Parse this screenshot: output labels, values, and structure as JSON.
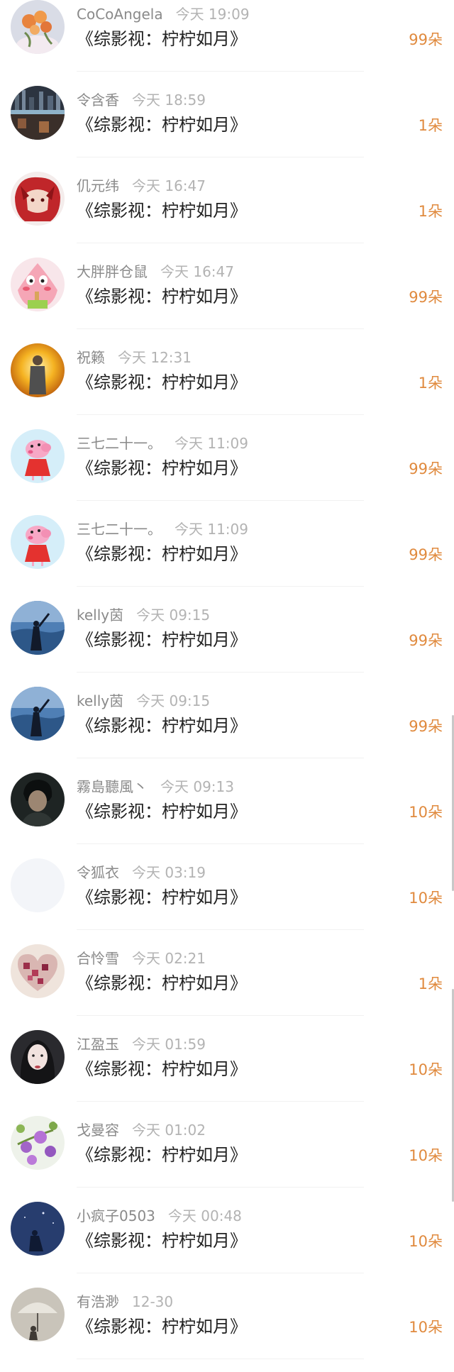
{
  "colors": {
    "gift_count": "#e08a3e",
    "name": "#8a8a8a",
    "time": "#b3b3b3",
    "title": "#222222"
  },
  "entries": [
    {
      "name": "CoCoAngela",
      "time": "今天 19:09",
      "title": "《综影视：柠柠如月》",
      "count": "99朵",
      "avatar_icon": "flowers-avatar"
    },
    {
      "name": "令含香",
      "time": "今天 18:59",
      "title": "《综影视：柠柠如月》",
      "count": "1朵",
      "avatar_icon": "cityscape-avatar"
    },
    {
      "name": "仉元纬",
      "time": "今天 16:47",
      "title": "《综影视：柠柠如月》",
      "count": "1朵",
      "avatar_icon": "red-hair-anime-avatar"
    },
    {
      "name": "大胖胖仓鼠",
      "time": "今天 16:47",
      "title": "《综影视：柠柠如月》",
      "count": "99朵",
      "avatar_icon": "patrick-star-avatar"
    },
    {
      "name": "祝籁",
      "time": "今天 12:31",
      "title": "《综影视：柠柠如月》",
      "count": "1朵",
      "avatar_icon": "person-golden-halo-avatar"
    },
    {
      "name": "三七二十一。",
      "time": "今天 11:09",
      "title": "《综影视：柠柠如月》",
      "count": "99朵",
      "avatar_icon": "peppa-pig-avatar"
    },
    {
      "name": "三七二十一。",
      "time": "今天 11:09",
      "title": "《综影视：柠柠如月》",
      "count": "99朵",
      "avatar_icon": "peppa-pig-avatar"
    },
    {
      "name": "kelly茵",
      "time": "今天 09:15",
      "title": "《综影视：柠柠如月》",
      "count": "99朵",
      "avatar_icon": "silhouette-sky-avatar"
    },
    {
      "name": "kelly茵",
      "time": "今天 09:15",
      "title": "《综影视：柠柠如月》",
      "count": "99朵",
      "avatar_icon": "silhouette-sky-avatar"
    },
    {
      "name": "霧島聽風丶",
      "time": "今天 09:13",
      "title": "《综影视：柠柠如月》",
      "count": "10朵",
      "avatar_icon": "dark-portrait-avatar"
    },
    {
      "name": "令狐衣",
      "time": "今天 03:19",
      "title": "《综影视：柠柠如月》",
      "count": "10朵",
      "avatar_icon": "blank-avatar"
    },
    {
      "name": "合怜雪",
      "time": "今天 02:21",
      "title": "《综影视：柠柠如月》",
      "count": "1朵",
      "avatar_icon": "puzzle-heart-avatar"
    },
    {
      "name": "江盈玉",
      "time": "今天 01:59",
      "title": "《综影视：柠柠如月》",
      "count": "10朵",
      "avatar_icon": "woman-portrait-avatar"
    },
    {
      "name": "戈曼容",
      "time": "今天 01:02",
      "title": "《综影视：柠柠如月》",
      "count": "10朵",
      "avatar_icon": "purple-flowers-avatar"
    },
    {
      "name": "小疯子0503",
      "time": "今天 00:48",
      "title": "《综影视：柠柠如月》",
      "count": "10朵",
      "avatar_icon": "night-sky-avatar"
    },
    {
      "name": "有浩渺",
      "time": "12-30",
      "title": "《综影视：柠柠如月》",
      "count": "10朵",
      "avatar_icon": "umbrella-avatar"
    }
  ]
}
